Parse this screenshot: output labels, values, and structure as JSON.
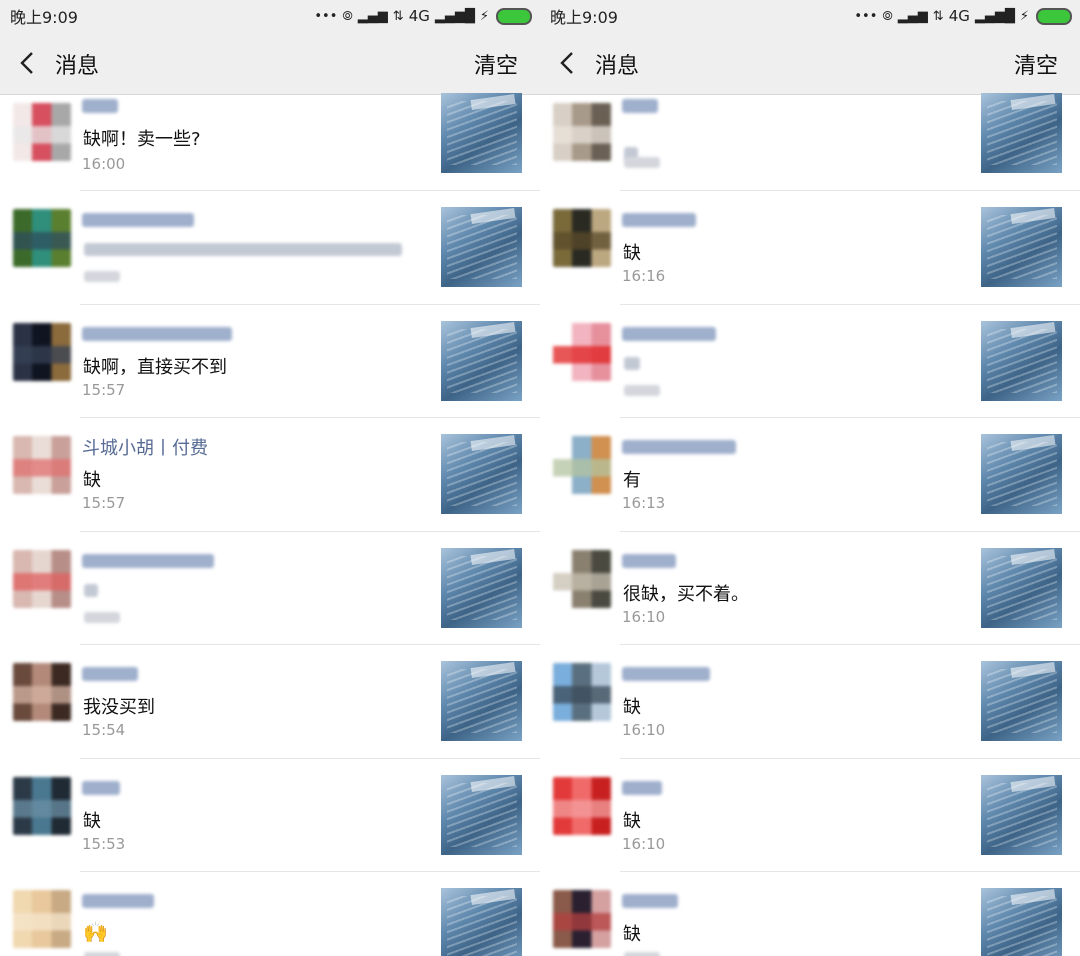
{
  "panels": [
    {
      "status": {
        "time": "晚上9:09",
        "network": "4G"
      },
      "header": {
        "title": "消息",
        "clear_label": "清空"
      },
      "messages": [
        {
          "text": "缺啊！卖一些?",
          "time": "16:00",
          "name_w": 36,
          "avatar": [
            "#f3e8e8",
            "#d65060",
            "#a8a8a8",
            "#e8e8e8"
          ]
        },
        {
          "text": "",
          "time": "",
          "name_w": 112,
          "line_w": 318,
          "avatar": [
            "#3c6a2a",
            "#2f8f7a",
            "#5a7f2f",
            "#2e4d5e"
          ]
        },
        {
          "text": "缺啊，直接买不到",
          "time": "15:57",
          "name_w": 150,
          "avatar": [
            "#2b3246",
            "#0f1420",
            "#8b6a3c",
            "#364256"
          ]
        },
        {
          "name": "斗城小胡丨付费",
          "text": "缺",
          "time": "15:57",
          "avatar": [
            "#d8b8b0",
            "#eadcd6",
            "#c9a09a",
            "#e07070"
          ]
        },
        {
          "text": "",
          "time": "",
          "name_w": 132,
          "line_w": 14,
          "avatar": [
            "#d8b8b0",
            "#e6d6d0",
            "#b88e88",
            "#e06060"
          ]
        },
        {
          "text": "我没买到",
          "time": "15:54",
          "name_w": 56,
          "avatar": [
            "#6a4a3c",
            "#b38a7a",
            "#3c2a22",
            "#d6b4a4"
          ]
        },
        {
          "text": "缺",
          "time": "15:53",
          "name_w": 38,
          "avatar": [
            "#2c3a48",
            "#4a7890",
            "#1f2a34",
            "#6a8fa4"
          ]
        },
        {
          "text": "🙌",
          "time": "",
          "name_w": 72,
          "avatar": [
            "#f0d8b0",
            "#e8c89c",
            "#c8aa84",
            "#f6e6cc"
          ]
        }
      ]
    },
    {
      "status": {
        "time": "晚上9:09",
        "network": "4G"
      },
      "header": {
        "title": "消息",
        "clear_label": "清空"
      },
      "messages": [
        {
          "text": "",
          "time": "",
          "name_w": 36,
          "line_w": 14,
          "avatar": [
            "#d8d0c6",
            "#a89a8a",
            "#6a6054",
            "#eae4dc"
          ]
        },
        {
          "text": "缺",
          "time": "16:16",
          "name_w": 74,
          "avatar": [
            "#7a6a3a",
            "#2a2a22",
            "#bca880",
            "#5a4a2a"
          ]
        },
        {
          "text": "",
          "time": "",
          "name_w": 94,
          "line_w": 16,
          "avatar": [
            "#ffffff",
            "#f2b4c0",
            "#e6909c",
            "#e02020"
          ]
        },
        {
          "text": "有",
          "time": "16:13",
          "name_w": 114,
          "avatar": [
            "#ffffff",
            "#8cb0c8",
            "#d09050",
            "#b4c4a0"
          ]
        },
        {
          "text": "很缺，买不着。",
          "time": "16:10",
          "name_w": 54,
          "avatar": [
            "#ffffff",
            "#8a8070",
            "#4a4a40",
            "#c8c0b0"
          ]
        },
        {
          "text": "缺",
          "time": "16:10",
          "name_w": 88,
          "avatar": [
            "#7aaedc",
            "#5a7080",
            "#b4c8da",
            "#3a4a58"
          ]
        },
        {
          "text": "缺",
          "time": "16:10",
          "name_w": 40,
          "avatar": [
            "#e23a3a",
            "#f06a6a",
            "#c82020",
            "#f4a0a0"
          ]
        },
        {
          "text": "缺",
          "time": "",
          "name_w": 56,
          "avatar": [
            "#8a5a4a",
            "#2a2030",
            "#d4a0a0",
            "#b44040"
          ]
        }
      ]
    }
  ]
}
